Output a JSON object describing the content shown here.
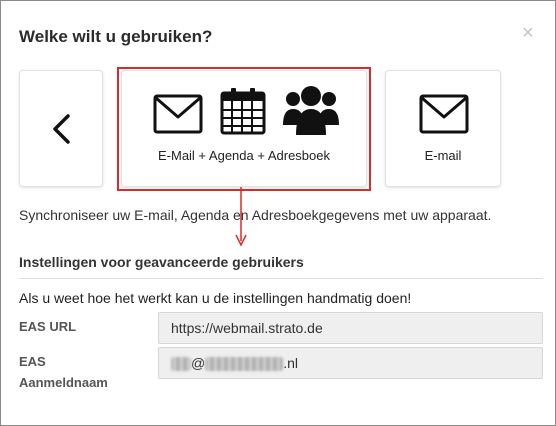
{
  "dialog": {
    "title": "Welke wilt u gebruiken?",
    "close_glyph": "×"
  },
  "options": {
    "back_icon": "chevron-left-icon",
    "main": {
      "label": "E-Mail + Agenda + Adresboek",
      "icons": [
        "envelope-icon",
        "calendar-icon",
        "contacts-group-icon"
      ],
      "selected": true
    },
    "email": {
      "label": "E-mail",
      "icons": [
        "envelope-icon"
      ]
    }
  },
  "description": "Synchroniseer uw E-mail, Agenda en Adresboekgegevens met uw apparaat.",
  "advanced": {
    "title": "Instellingen voor geavanceerde gebruikers",
    "hint": "Als u weet hoe het werkt kan u de instellingen handmatig doen!",
    "eas_url": {
      "label": "EAS URL",
      "value": "https://webmail.strato.de"
    },
    "eas_login": {
      "label_line1": "EAS",
      "label_line2": "Aanmeldnaam",
      "at": "@",
      "suffix": ".nl"
    }
  },
  "colors": {
    "highlight": "#d92b2b",
    "field_bg": "#efefef"
  }
}
